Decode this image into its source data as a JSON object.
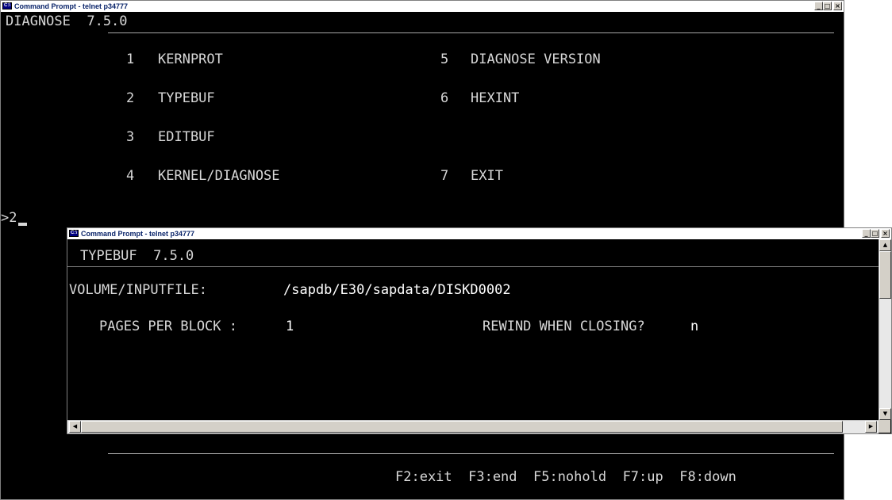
{
  "back_window": {
    "title": "Command Prompt - telnet p34777",
    "header": "DIAGNOSE  7.5.0",
    "menu": [
      {
        "num": "1",
        "label": "KERNPROT"
      },
      {
        "num": "2",
        "label": "TYPEBUF"
      },
      {
        "num": "3",
        "label": "EDITBUF"
      },
      {
        "num": "4",
        "label": "KERNEL/DIAGNOSE"
      },
      {
        "num": "5",
        "label": "DIAGNOSE VERSION"
      },
      {
        "num": "6",
        "label": "HEXINT"
      },
      {
        "num": "7",
        "label": "EXIT"
      }
    ],
    "prompt": ">2",
    "function_keys": "F2:exit  F3:end  F5:nohold  F7:up  F8:down"
  },
  "front_window": {
    "title": "Command Prompt - telnet p34777",
    "header": "TYPEBUF  7.5.0",
    "volume_label": "VOLUME/INPUTFILE:",
    "volume_value": "/sapdb/E30/sapdata/DISKD0002",
    "pages_label": "PAGES PER BLOCK : ",
    "pages_value": "1",
    "rewind_label": "REWIND WHEN CLOSING? ",
    "rewind_value": "n"
  },
  "window_controls": {
    "minimize": "_",
    "maximize": "□",
    "close": "×"
  },
  "icons": [
    "cmd-window-icon",
    "minimize-icon",
    "maximize-icon",
    "close-icon",
    "scroll-up-arrow-icon",
    "scroll-down-arrow-icon",
    "scroll-left-arrow-icon",
    "scroll-right-arrow-icon"
  ]
}
